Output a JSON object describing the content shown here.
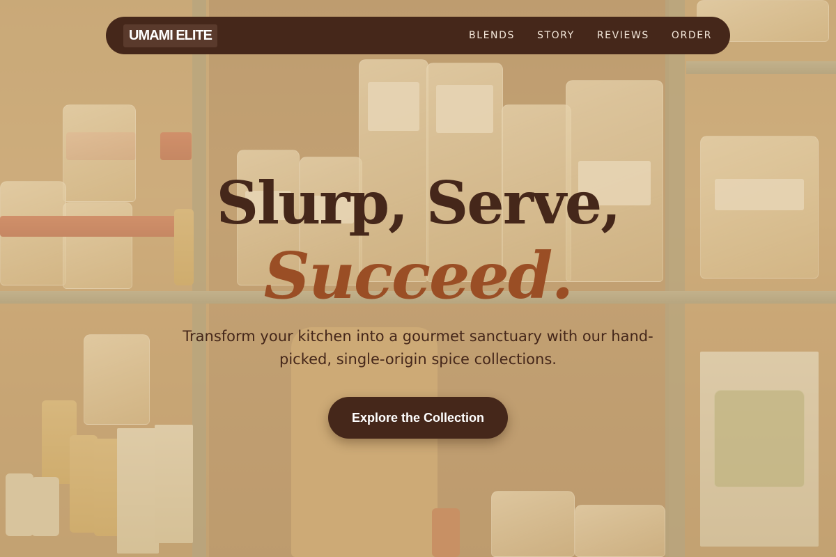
{
  "nav": {
    "logo": "UMAMI ELITE",
    "links": [
      "BLENDS",
      "STORY",
      "REVIEWS",
      "ORDER"
    ]
  },
  "hero": {
    "headline_line1": "Slurp, Serve,",
    "headline_line2": "Succeed.",
    "subtitle": "Transform your kitchen into a gourmet sanctuary with our hand-picked, single-origin spice collections.",
    "cta_label": "Explore the Collection"
  },
  "colors": {
    "brand_dark": "#45271a",
    "accent": "#9a4e25",
    "overlay": "#d6ba8c"
  }
}
